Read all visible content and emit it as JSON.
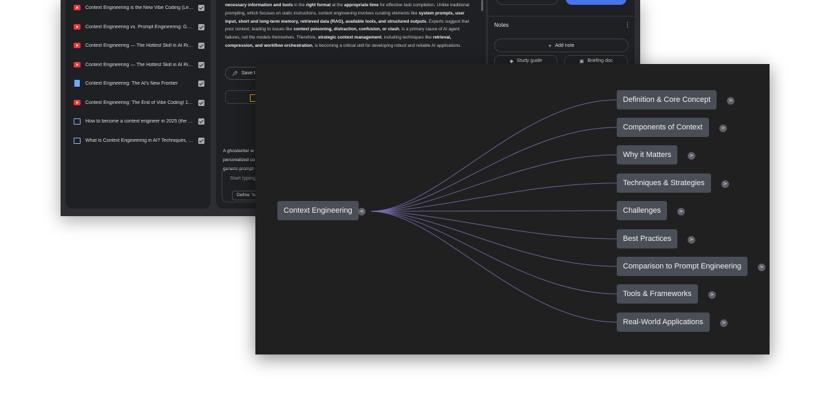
{
  "sources": {
    "items": [
      {
        "type": "youtube-icon",
        "title": "Context Engineering is the New Vibe Coding (Le…"
      },
      {
        "type": "youtube-icon",
        "title": "Context Engineering vs. Prompt Engineering: Gu…"
      },
      {
        "type": "youtube-icon",
        "title": "Context Engineering — The Hottest Skill in AI Rig…"
      },
      {
        "type": "youtube-icon",
        "title": "Context Engineering — The Hottest Skill in AI Rig…"
      },
      {
        "type": "document-icon",
        "title": "Context Engineering: The AI's New Frontier"
      },
      {
        "type": "youtube-icon",
        "title": "Context Engineering: The End of Vibe Coding! 1…"
      },
      {
        "type": "web-icon",
        "title": "How to become a context engineer in 2025 (the …"
      },
      {
        "type": "web-icon",
        "title": "What Is Context Engineering in AI? Techniques, …"
      }
    ]
  },
  "chat": {
    "summary": [
      [
        {
          "t": "necessary information and tools",
          "b": true
        },
        {
          "t": " in the "
        },
        {
          "t": "right format",
          "b": true
        },
        {
          "t": " at the "
        },
        {
          "t": "appropriate time",
          "b": true
        },
        {
          "t": " for effective task completion. Unlike traditional prompting, which focuses on static instructions, context engineering involves curating elements like "
        },
        {
          "t": "system prompts, user input, short and long-term memory, retrieved data (RAG), available tools, and structured outputs",
          "b": true
        },
        {
          "t": ". Experts suggest that poor context, leading to issues like "
        },
        {
          "t": "context poisoning, distraction, confusion, or clash",
          "b": true
        },
        {
          "t": ", is a primary cause of AI agent failures, not the models themselves. Therefore, "
        },
        {
          "t": "strategic context management",
          "b": true
        },
        {
          "t": ", including techniques like "
        },
        {
          "t": "retrieval, compression, and workflow orchestration",
          "b": true
        },
        {
          "t": ", is becoming a critical skill for developing robust and reliable AI applications."
        }
      ]
    ],
    "save_note_label": "Save to",
    "response_lines": [
      "A ghostwriter w",
      "personalized co",
      "generic prompt"
    ],
    "input_placeholder": "Start typing",
    "suggestion": "Define \"con"
  },
  "studio": {
    "notes_title": "Notes",
    "add_note_label": "Add note",
    "chips": [
      {
        "icon": "graduation-cap-icon",
        "label": "Study guide"
      },
      {
        "icon": "document-icon",
        "label": "Briefing doc"
      }
    ]
  },
  "mindmap": {
    "root": {
      "label": "Context Engineering",
      "toggle": "<"
    },
    "children": [
      {
        "label": "Definition & Core Concept",
        "toggle": ">"
      },
      {
        "label": "Components of Context",
        "toggle": ">"
      },
      {
        "label": "Why it Matters",
        "toggle": ">"
      },
      {
        "label": "Techniques & Strategies",
        "toggle": ">"
      },
      {
        "label": "Challenges",
        "toggle": ">"
      },
      {
        "label": "Best Practices",
        "toggle": ">"
      },
      {
        "label": "Comparison to Prompt Engineering",
        "toggle": ">"
      },
      {
        "label": "Tools & Frameworks",
        "toggle": ">"
      },
      {
        "label": "Real-World Applications",
        "toggle": ">"
      }
    ],
    "colors": {
      "edge": "#7a6fb0",
      "node": "#4a4e57",
      "background": "#202020"
    }
  }
}
